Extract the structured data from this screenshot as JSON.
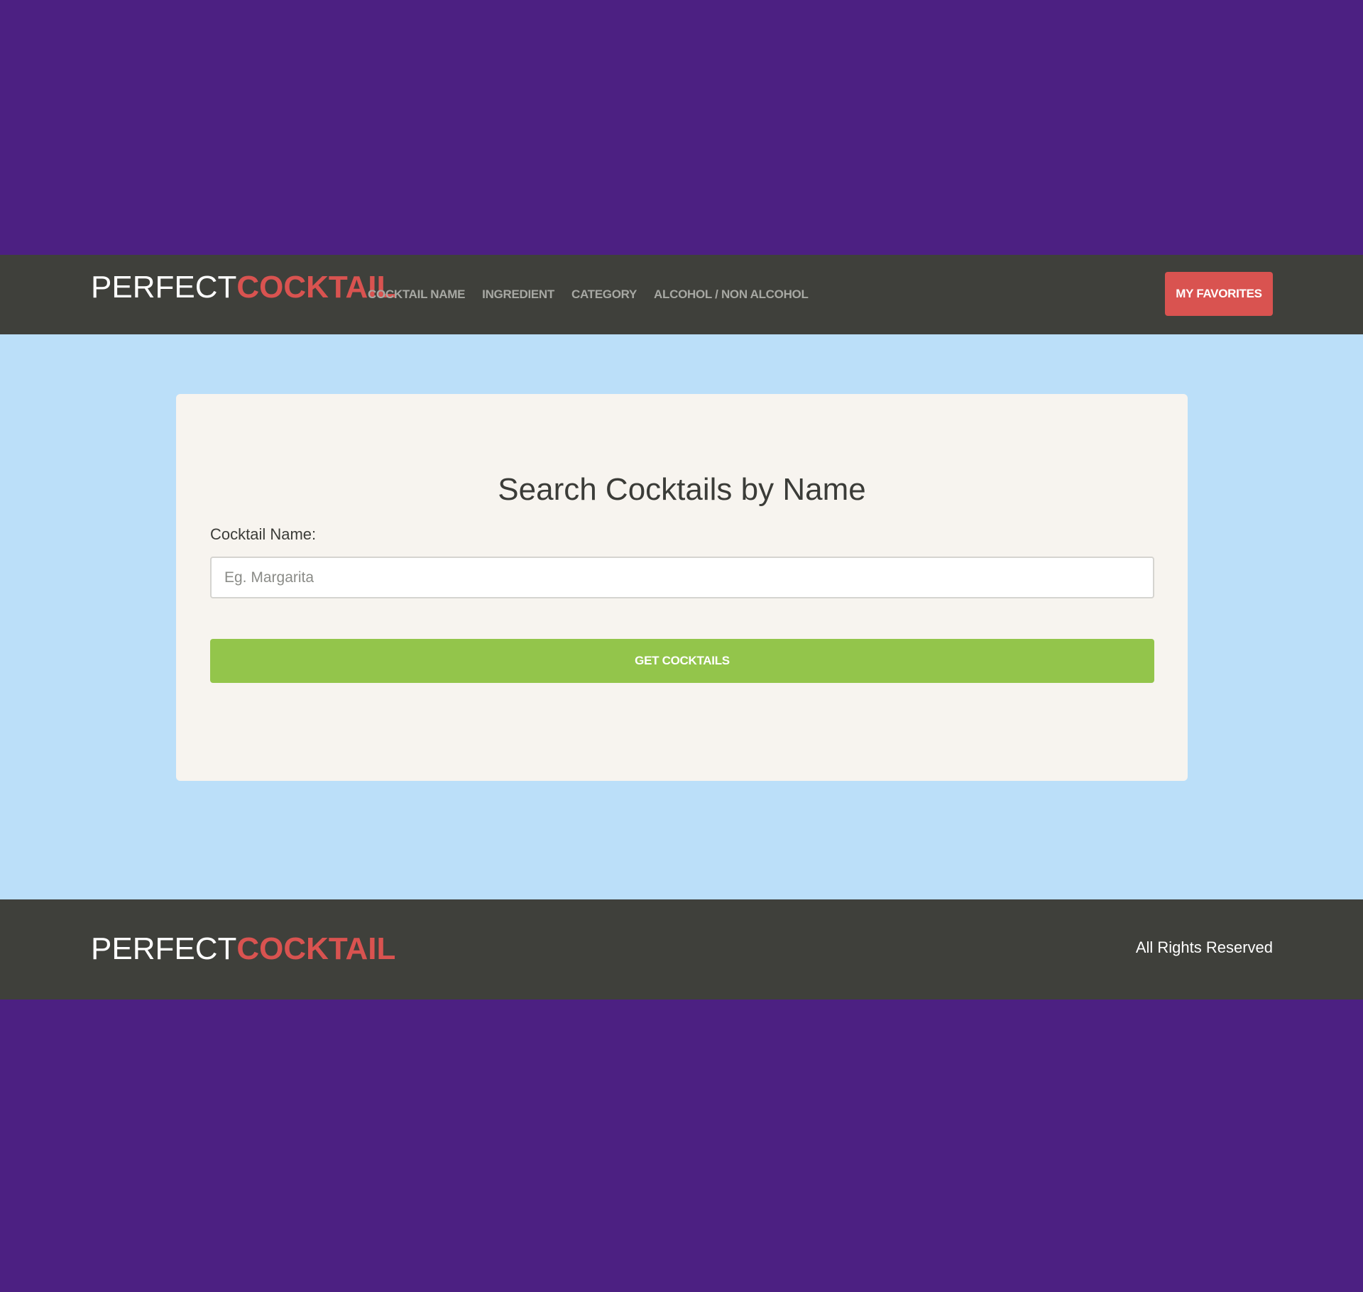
{
  "colors": {
    "page_background": "#4c2082",
    "navbar_background": "#3f403b",
    "main_background": "#bbdff9",
    "card_background": "#f7f4ef",
    "brand_accent": "#d95350",
    "nav_link": "#a7a8a3",
    "success_button": "#93c54b"
  },
  "header": {
    "brand": {
      "light": "PERFECT",
      "bold": "COCKTAIL"
    },
    "nav": [
      {
        "label": "COCKTAIL NAME"
      },
      {
        "label": "INGREDIENT"
      },
      {
        "label": "CATEGORY"
      },
      {
        "label": "ALCOHOL / NON ALCOHOL"
      }
    ],
    "favorites_label": "MY FAVORITES"
  },
  "search": {
    "title": "Search Cocktails by Name",
    "label": "Cocktail Name:",
    "placeholder": "Eg. Margarita",
    "value": "",
    "submit_label": "GET COCKTAILS"
  },
  "footer": {
    "brand": {
      "light": "PERFECT",
      "bold": "COCKTAIL"
    },
    "copyright": "All Rights Reserved"
  }
}
